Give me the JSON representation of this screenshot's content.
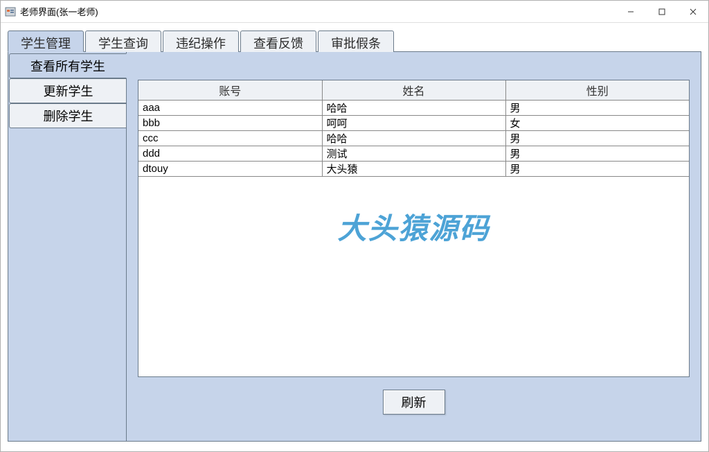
{
  "titlebar": {
    "title": "老师界面(张一老师)"
  },
  "top_tabs": [
    {
      "label": "学生管理",
      "active": true
    },
    {
      "label": "学生查询",
      "active": false
    },
    {
      "label": "违纪操作",
      "active": false
    },
    {
      "label": "查看反馈",
      "active": false
    },
    {
      "label": "审批假条",
      "active": false
    }
  ],
  "left_tabs": [
    {
      "label": "查看所有学生",
      "active": true
    },
    {
      "label": "更新学生",
      "active": false
    },
    {
      "label": "删除学生",
      "active": false
    }
  ],
  "table": {
    "columns": [
      "账号",
      "姓名",
      "性别"
    ],
    "rows": [
      {
        "account": "aaa",
        "name": "哈哈",
        "gender": "男"
      },
      {
        "account": "bbb",
        "name": "呵呵",
        "gender": "女"
      },
      {
        "account": "ccc",
        "name": "哈哈",
        "gender": "男"
      },
      {
        "account": "ddd",
        "name": "测试",
        "gender": "男"
      },
      {
        "account": "dtouy",
        "name": "大头猿",
        "gender": "男"
      }
    ]
  },
  "buttons": {
    "refresh": "刷新"
  },
  "watermark": "大头猿源码"
}
